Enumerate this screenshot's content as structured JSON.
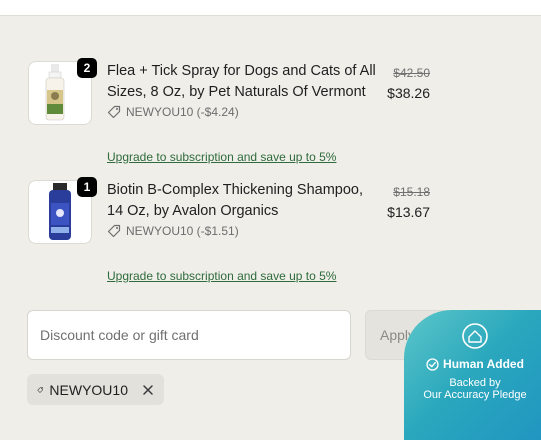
{
  "items": [
    {
      "quantity": "2",
      "title": "Flea + Tick Spray for Dogs and Cats of All Sizes, 8 Oz, by Pet Naturals Of Vermont",
      "discount": "NEWYOU10 (-$4.24)",
      "original_price": "$42.50",
      "price": "$38.26",
      "upgrade_link": "Upgrade to subscription and save up to 5%"
    },
    {
      "quantity": "1",
      "title": "Biotin B-Complex Thickening Shampoo, 14 Oz, by Avalon Organics",
      "discount": "NEWYOU10 (-$1.51)",
      "original_price": "$15.18",
      "price": "$13.67",
      "upgrade_link": "Upgrade to subscription and save up to 5%"
    }
  ],
  "discount_form": {
    "placeholder": "Discount code or gift card",
    "apply_label": "Apply"
  },
  "applied_code": {
    "code": "NEWYOU10"
  },
  "trust_badge": {
    "headline": "Human Added",
    "line1": "Backed by",
    "line2": "Our Accuracy Pledge"
  },
  "colors": {
    "background": "#efeee9",
    "link_green": "#2f6b3c",
    "badge_teal": "#2aa7bd"
  }
}
